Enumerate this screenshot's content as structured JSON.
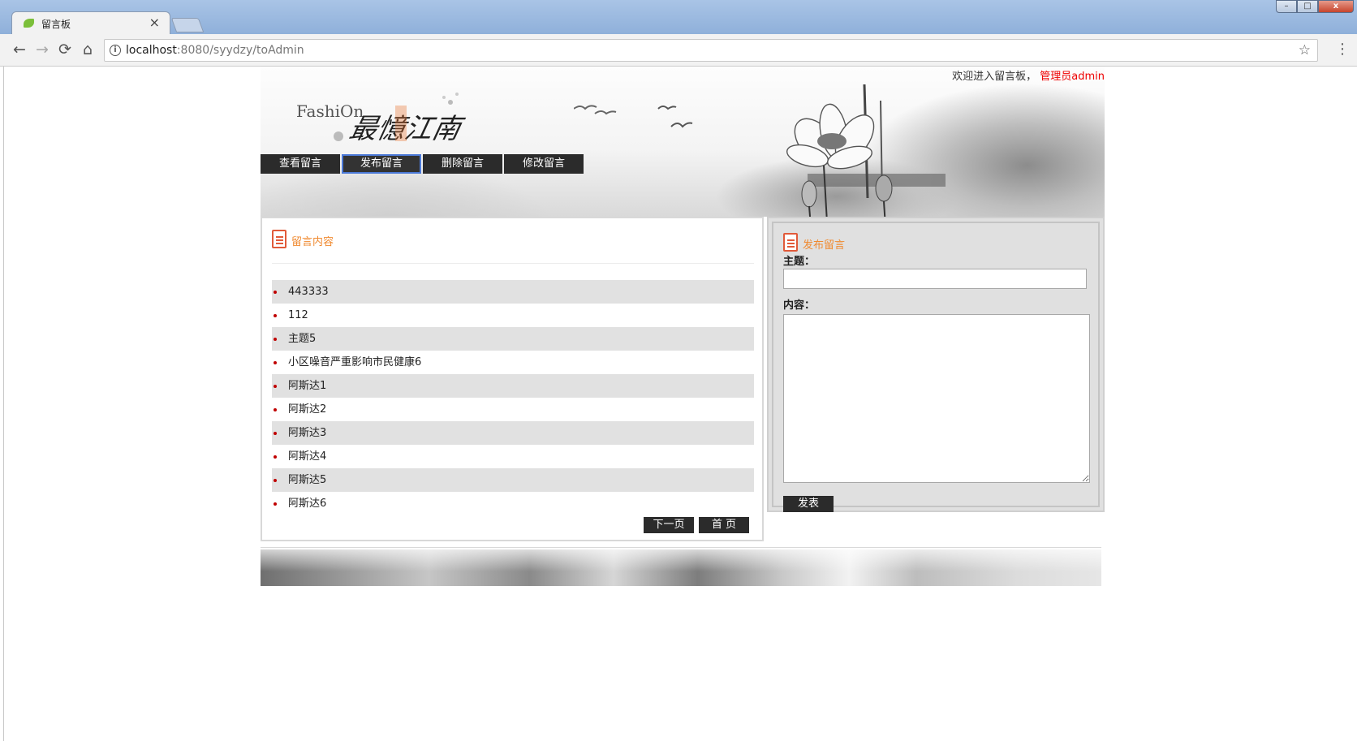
{
  "browser": {
    "tab_title": "留言板",
    "tab_close": "×",
    "url_host": "localhost",
    "url_path": ":8080/syydzy/toAdmin",
    "controls": {
      "minimize": "–",
      "maximize": "□",
      "close": "x"
    },
    "icons": [
      "back-arrow-icon",
      "forward-arrow-icon",
      "reload-icon",
      "home-icon",
      "info-icon",
      "bookmark-star-icon",
      "menu-dots-icon"
    ]
  },
  "header": {
    "welcome_text": "欢迎进入留言板，",
    "admin_text": "管理员admin",
    "logo_latin": "FashiOn",
    "logo_cjk": "最憶江南",
    "nav": [
      {
        "label": "查看留言",
        "active": false
      },
      {
        "label": "发布留言",
        "active": true
      },
      {
        "label": "删除留言",
        "active": false
      },
      {
        "label": "修改留言",
        "active": false
      }
    ]
  },
  "messages_panel": {
    "title": "留言内容",
    "items": [
      "443333",
      "112",
      "主题5",
      "小区噪音严重影响市民健康6",
      "阿斯达1",
      "阿斯达2",
      "阿斯达3",
      "阿斯达4",
      "阿斯达5",
      "阿斯达6"
    ],
    "next_page": "下一页",
    "first_page": "首 页"
  },
  "publish_panel": {
    "title": "发布留言",
    "subject_label": "主题：",
    "subject_value": "",
    "content_label": "内容：",
    "content_value": "",
    "submit_label": "发表"
  },
  "colors": {
    "accent_orange": "#f08a30",
    "admin_red": "#e00000",
    "button_dark": "#2b2b2b",
    "stripe_gray": "#e1e1e1"
  }
}
